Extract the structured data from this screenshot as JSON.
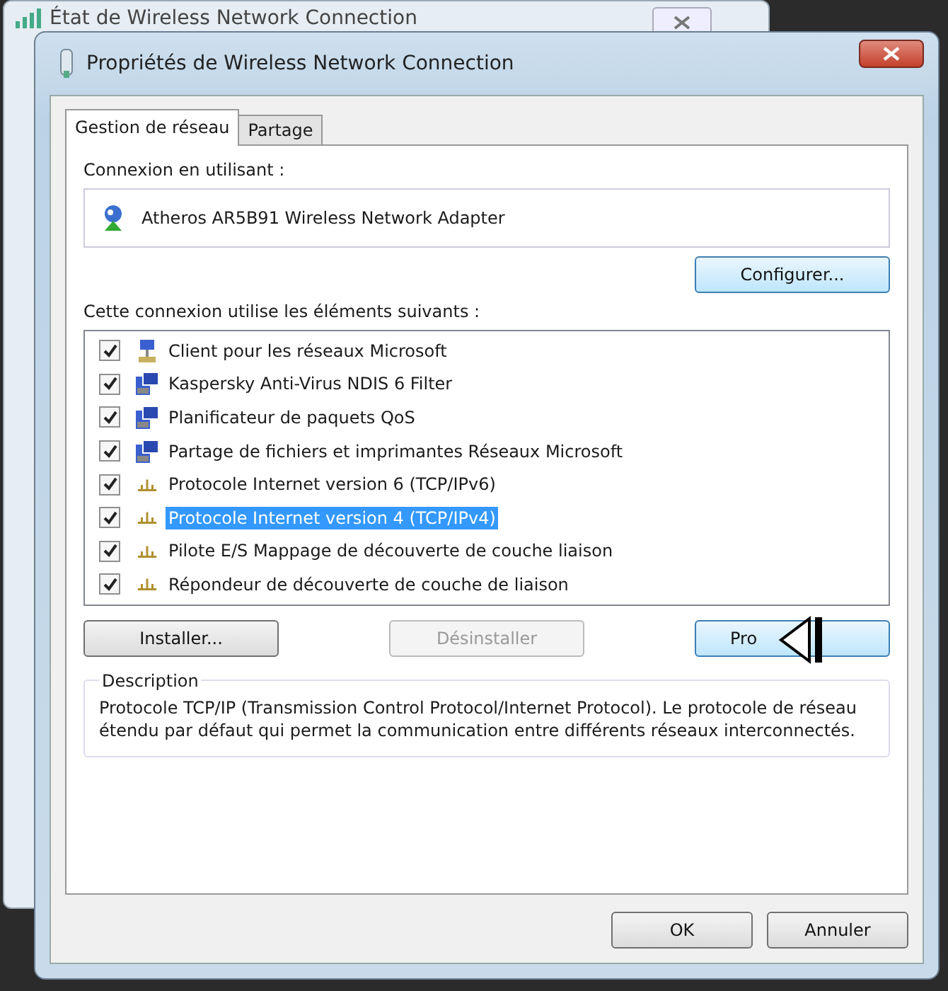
{
  "background_window": {
    "title": "État de Wireless Network Connection"
  },
  "window": {
    "title": "Propriétés de Wireless Network Connection"
  },
  "tabs": [
    {
      "label": "Gestion de réseau",
      "selected": true
    },
    {
      "label": "Partage",
      "selected": false
    }
  ],
  "connection": {
    "label": "Connexion en utilisant :",
    "adapter": "Atheros AR5B91 Wireless Network Adapter",
    "configure_button": "Configurer..."
  },
  "components": {
    "label": "Cette connexion utilise les éléments suivants :",
    "items": [
      {
        "label": "Client pour les réseaux Microsoft",
        "kind": "client",
        "checked": true,
        "selected": false
      },
      {
        "label": "Kaspersky Anti-Virus NDIS 6 Filter",
        "kind": "service",
        "checked": true,
        "selected": false
      },
      {
        "label": "Planificateur de paquets QoS",
        "kind": "service",
        "checked": true,
        "selected": false
      },
      {
        "label": "Partage de fichiers et imprimantes Réseaux Microsoft",
        "kind": "service",
        "checked": true,
        "selected": false
      },
      {
        "label": "Protocole Internet version 6 (TCP/IPv6)",
        "kind": "protocol",
        "checked": true,
        "selected": false
      },
      {
        "label": "Protocole Internet version 4 (TCP/IPv4)",
        "kind": "protocol",
        "checked": true,
        "selected": true
      },
      {
        "label": "Pilote E/S Mappage de découverte de couche liaison",
        "kind": "protocol",
        "checked": true,
        "selected": false
      },
      {
        "label": "Répondeur de découverte de couche de liaison",
        "kind": "protocol",
        "checked": true,
        "selected": false
      }
    ]
  },
  "item_buttons": [
    {
      "label": "Installer...",
      "disabled": false
    },
    {
      "label": "Désinstaller",
      "disabled": true
    },
    {
      "label": "Pro",
      "disabled": false
    }
  ],
  "description": {
    "title": "Description",
    "text": "Protocole TCP/IP (Transmission Control Protocol/Internet Protocol). Le protocole de réseau étendu par défaut qui permet la communication entre différents réseaux interconnectés."
  },
  "dialog_buttons": [
    "OK",
    "Annuler"
  ]
}
